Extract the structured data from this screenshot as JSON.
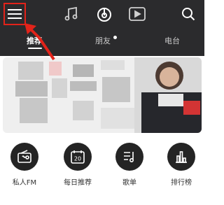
{
  "colors": {
    "topbar": "#2b2b2d",
    "highlight": "#e2231a",
    "icon_dark": "#242424",
    "label": "#333333"
  },
  "header": {
    "icons": [
      "menu-icon",
      "music-note-icon",
      "netease-cloud-icon",
      "video-play-icon",
      "search-icon"
    ]
  },
  "tabs": [
    {
      "label": "推荐",
      "active": true
    },
    {
      "label": "朋友",
      "active": false,
      "badge": true
    },
    {
      "label": "电台",
      "active": false
    }
  ],
  "quick_entries": [
    {
      "label": "私人FM",
      "icon": "radio-icon"
    },
    {
      "label": "每日推荐",
      "icon": "calendar-icon",
      "icon_text": "20"
    },
    {
      "label": "歌单",
      "icon": "playlist-icon"
    },
    {
      "label": "排行榜",
      "icon": "chart-icon"
    }
  ]
}
